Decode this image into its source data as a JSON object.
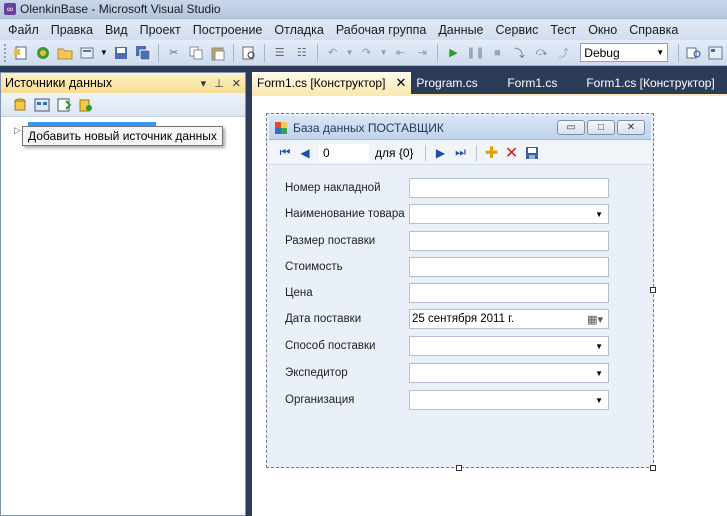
{
  "window": {
    "title": "OlenkinBase - Microsoft Visual Studio"
  },
  "menu": [
    "Файл",
    "Правка",
    "Вид",
    "Проект",
    "Построение",
    "Отладка",
    "Рабочая группа",
    "Данные",
    "Сервис",
    "Тест",
    "Окно",
    "Справка"
  ],
  "toolbar": {
    "config_combo": "Debug"
  },
  "data_sources_panel": {
    "title": "Источники данных",
    "pin_glyph": "▾",
    "close_glyph": "✕",
    "tooltip": "Добавить новый источник данных"
  },
  "tabs": [
    {
      "label": "Form1.cs [Конструктор]",
      "active": true
    },
    {
      "label": "Program.cs",
      "active": false
    },
    {
      "label": "Form1.cs",
      "active": false
    },
    {
      "label": "Form1.cs [Конструктор]",
      "active": false
    }
  ],
  "form": {
    "caption": "База данных ПОСТАВЩИК",
    "navigator": {
      "position": "0",
      "of_label": "для {0}"
    },
    "fields": [
      {
        "label": "Номер накладной",
        "value": "",
        "kind": "text"
      },
      {
        "label": "Наименование товара",
        "value": "",
        "kind": "combo"
      },
      {
        "label": "Размер поставки",
        "value": "",
        "kind": "text"
      },
      {
        "label": "Стоимость",
        "value": "",
        "kind": "text"
      },
      {
        "label": "Цена",
        "value": "",
        "kind": "text"
      },
      {
        "label": "Дата поставки",
        "value": "25 сентября 2011 г.",
        "kind": "date"
      },
      {
        "label": "Способ поставки",
        "value": "",
        "kind": "combo"
      },
      {
        "label": "Экспедитор",
        "value": "",
        "kind": "combo"
      },
      {
        "label": "Организация",
        "value": "",
        "kind": "combo"
      }
    ]
  },
  "colors": {
    "ide_background": "#2b3c59",
    "panel_header": "#f7dc8f",
    "active_tab": "#fbe9b0",
    "nav_icon": "#1f4fa8",
    "delete_icon": "#d42020",
    "add_icon": "#e0a000"
  }
}
